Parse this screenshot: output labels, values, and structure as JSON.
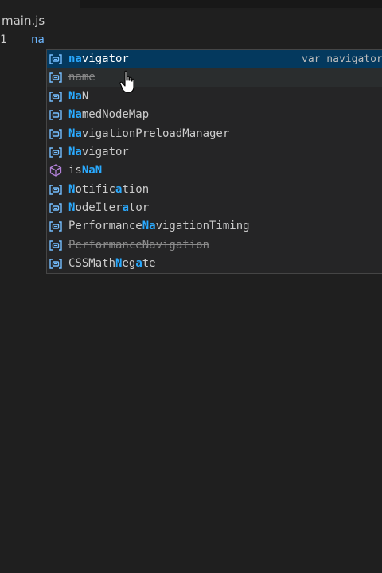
{
  "editor": {
    "tab_file": "main.js",
    "line_number": "1",
    "typed_text": "na"
  },
  "suggestions": [
    {
      "pre": "",
      "hl": "na",
      "rest": "vigator",
      "detail": "var navigator",
      "icon": "variable-icon",
      "selected": true
    },
    {
      "pre": "",
      "hl": "",
      "rest": "name",
      "icon": "variable-icon",
      "deprecated": true
    },
    {
      "pre": "",
      "hl": "Na",
      "rest": "N",
      "icon": "variable-icon"
    },
    {
      "pre": "",
      "hl": "Na",
      "rest": "medNodeMap",
      "icon": "variable-icon"
    },
    {
      "pre": "",
      "hl": "Na",
      "rest": "vigationPreloadManager",
      "icon": "variable-icon"
    },
    {
      "pre": "",
      "hl": "Na",
      "rest": "vigator",
      "icon": "variable-icon"
    },
    {
      "pre": "is",
      "hl": "NaN",
      "rest": "",
      "icon": "method-cube-icon"
    },
    {
      "pre": "",
      "hl": "N",
      "rest": "otific",
      "hl2": "a",
      "rest2": "tion",
      "icon": "variable-icon"
    },
    {
      "pre": "",
      "hl": "N",
      "rest": "odeIter",
      "hl2": "a",
      "rest2": "tor",
      "icon": "variable-icon"
    },
    {
      "pre": "Performance",
      "hl": "Na",
      "rest": "vigationTiming",
      "icon": "variable-icon"
    },
    {
      "pre": "",
      "hl": "",
      "rest": "PerformanceNavigation",
      "icon": "variable-icon",
      "deprecated": true
    },
    {
      "pre": "CSSMath",
      "hl": "N",
      "rest": "eg",
      "hl2": "a",
      "rest2": "te",
      "icon": "variable-icon"
    }
  ],
  "colors": {
    "variable_icon": "#75beff",
    "method_icon": "#b180d7",
    "selection": "#04395e",
    "match_highlight": "#2aaaff"
  }
}
